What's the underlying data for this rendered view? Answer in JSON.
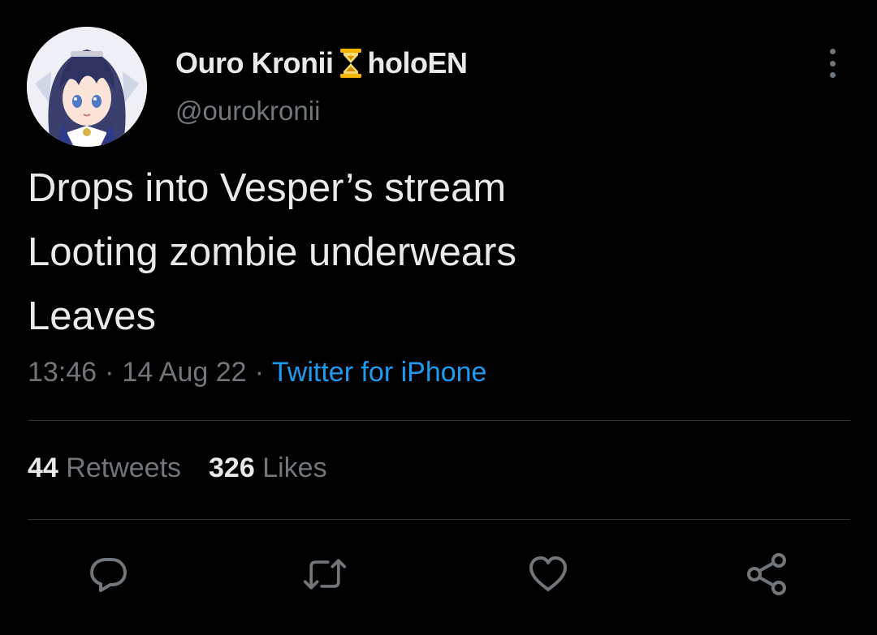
{
  "tweet": {
    "author": {
      "display_name_part1": "Ouro Kronii",
      "emoji": "hourglass-icon",
      "display_name_part2": "holoEN",
      "handle": "@ourokronii"
    },
    "text_lines": [
      "Drops into Vesper’s stream",
      "Looting zombie underwears",
      "Leaves"
    ],
    "time": "13:46",
    "separator": "·",
    "date": "14 Aug 22",
    "source": "Twitter for iPhone",
    "stats": {
      "retweets_count": "44",
      "retweets_label": "Retweets",
      "likes_count": "326",
      "likes_label": "Likes"
    },
    "actions": [
      "reply-icon",
      "retweet-icon",
      "like-icon",
      "share-icon"
    ]
  },
  "colors": {
    "background": "#000000",
    "text_primary": "#e7e9ea",
    "text_secondary": "#71767b",
    "link": "#1d9bf0",
    "divider": "#2f3336",
    "hourglass": "#f5b400"
  }
}
